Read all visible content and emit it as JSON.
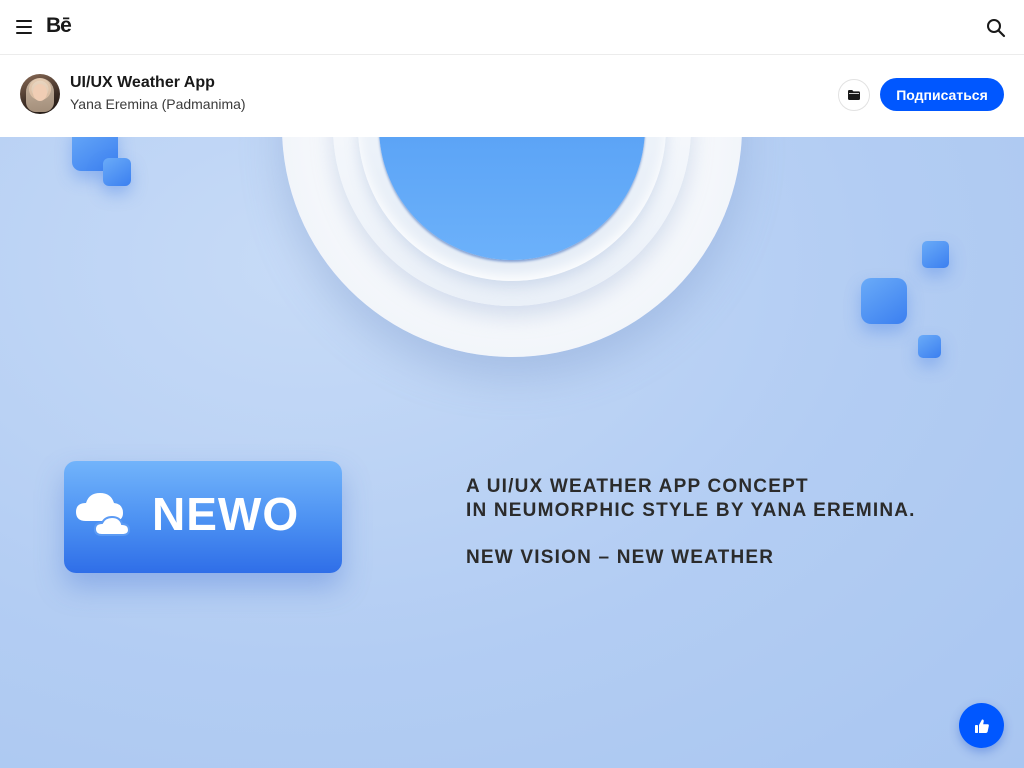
{
  "topbar": {
    "logo": "Bē",
    "menu_icon": "hamburger-icon",
    "search_icon": "search-icon"
  },
  "project": {
    "title": "UI/UX Weather App",
    "author": "Yana Eremina (Padmanima)",
    "save_icon": "folder-icon",
    "follow_label": "Подписаться",
    "accent": "#0057ff"
  },
  "artwork": {
    "brand": "NEWO",
    "tagline_line1": "A UI/UX WEATHER APP CONCEPT",
    "tagline_line2": "IN NEUMORPHIC STYLE BY YANA EREMINA.",
    "slogan": "NEW VISION – NEW WEATHER"
  },
  "like": {
    "icon": "thumbs-up-icon"
  }
}
